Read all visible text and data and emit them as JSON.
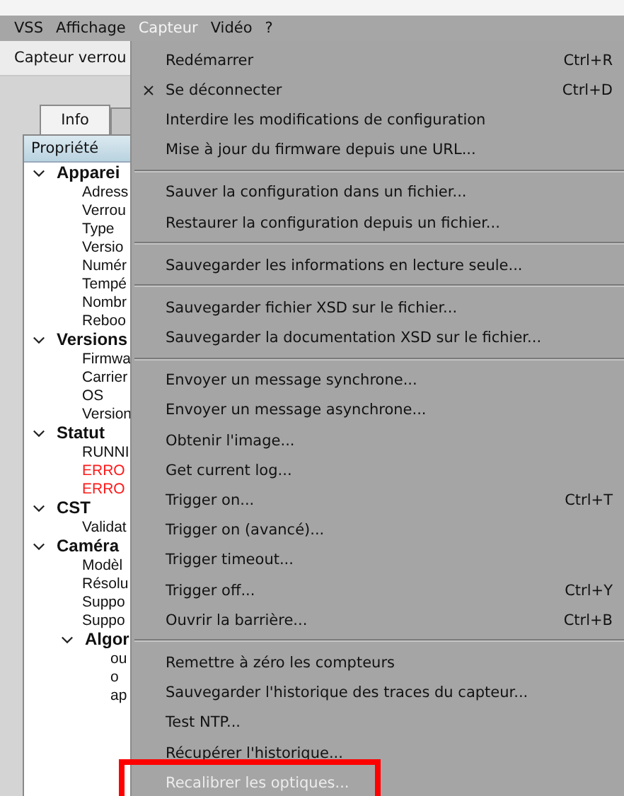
{
  "menubar": [
    {
      "label": "VSS",
      "selected": false
    },
    {
      "label": "Affichage",
      "selected": false
    },
    {
      "label": "Capteur",
      "selected": true
    },
    {
      "label": "Vidéo",
      "selected": false
    },
    {
      "label": "?",
      "selected": false
    }
  ],
  "window_label": "Capteur verrou",
  "tabs": [
    {
      "label": "Info",
      "selected": true
    },
    {
      "selected": false
    }
  ],
  "tree": {
    "header": "Propriété",
    "items": [
      {
        "label": "Apparei",
        "expanded": true,
        "children": [
          {
            "label": "Adress"
          },
          {
            "label": "Verrou"
          },
          {
            "label": "Type"
          },
          {
            "label": "Versio"
          },
          {
            "label": "Numér"
          },
          {
            "label": "Tempé"
          },
          {
            "label": "Nombr"
          },
          {
            "label": "Reboo"
          }
        ]
      },
      {
        "label": "Versions",
        "expanded": true,
        "children": [
          {
            "label": "Firmwa"
          },
          {
            "label": "Carrier"
          },
          {
            "label": "OS"
          },
          {
            "label": "Version"
          }
        ]
      },
      {
        "label": "Statut",
        "expanded": true,
        "children": [
          {
            "label": "RUNNI",
            "error": false
          },
          {
            "label": "ERRO",
            "error": true
          },
          {
            "label": "ERRO",
            "error": true
          }
        ]
      },
      {
        "label": "CST",
        "expanded": true,
        "children": [
          {
            "label": "Validat"
          }
        ]
      },
      {
        "label": "Caméra",
        "expanded": true,
        "children": [
          {
            "label": "Modèl"
          },
          {
            "label": "Résolu"
          },
          {
            "label": "Suppo"
          },
          {
            "label": "Suppo"
          },
          {
            "label": "Algor",
            "expanded": true,
            "children": [
              {
                "label": "ou"
              },
              {
                "label": "o"
              },
              {
                "label": "ap"
              }
            ]
          }
        ]
      }
    ]
  },
  "menu": {
    "sections": [
      [
        {
          "label": "Redémarrer",
          "shortcut": "Ctrl+R",
          "checked": false,
          "disabled": false,
          "highlighted": false
        },
        {
          "label": "Se déconnecter",
          "shortcut": "Ctrl+D",
          "checked": true,
          "disabled": false,
          "highlighted": false
        },
        {
          "label": "Interdire les modifications de configuration",
          "checked": false,
          "disabled": false,
          "highlighted": false
        },
        {
          "label": "Mise à jour du firmware depuis une URL...",
          "checked": false,
          "disabled": false,
          "highlighted": false
        }
      ],
      [
        {
          "label": "Sauver la configuration dans un fichier...",
          "checked": false,
          "disabled": false,
          "highlighted": false
        },
        {
          "label": "Restaurer la configuration depuis un fichier...",
          "checked": false,
          "disabled": false,
          "highlighted": false
        }
      ],
      [
        {
          "label": "Sauvegarder les informations en lecture seule...",
          "checked": false,
          "disabled": false,
          "highlighted": false
        }
      ],
      [
        {
          "label": "Sauvegarder fichier XSD sur le fichier...",
          "checked": false,
          "disabled": false,
          "highlighted": false
        },
        {
          "label": "Sauvegarder la documentation XSD sur le fichier...",
          "checked": false,
          "disabled": false,
          "highlighted": false
        }
      ],
      [
        {
          "label": "Envoyer un message synchrone...",
          "checked": false,
          "disabled": false,
          "highlighted": false
        },
        {
          "label": "Envoyer un message asynchrone...",
          "checked": false,
          "disabled": false,
          "highlighted": false
        },
        {
          "label": "Obtenir l'image...",
          "checked": false,
          "disabled": false,
          "highlighted": false
        },
        {
          "label": "Get current log...",
          "checked": false,
          "disabled": false,
          "highlighted": false
        },
        {
          "label": "Trigger on...",
          "shortcut": "Ctrl+T",
          "checked": false,
          "disabled": false,
          "highlighted": false
        },
        {
          "label": "Trigger on (avancé)...",
          "checked": false,
          "disabled": false,
          "highlighted": false
        },
        {
          "label": "Trigger timeout...",
          "checked": false,
          "disabled": false,
          "highlighted": false
        },
        {
          "label": "Trigger off...",
          "shortcut": "Ctrl+Y",
          "checked": false,
          "disabled": false,
          "highlighted": false
        },
        {
          "label": "Ouvrir la barrière...",
          "shortcut": "Ctrl+B",
          "checked": false,
          "disabled": false,
          "highlighted": false
        }
      ],
      [
        {
          "label": "Remettre à zéro les compteurs",
          "checked": false,
          "disabled": false,
          "highlighted": false
        },
        {
          "label": "Sauvegarder l'historique des traces du capteur...",
          "checked": false,
          "disabled": false,
          "highlighted": false
        },
        {
          "label": "Test NTP...",
          "checked": false,
          "disabled": false,
          "highlighted": false
        },
        {
          "label": "Récupérer l'historique...",
          "checked": false,
          "disabled": false,
          "highlighted": false
        },
        {
          "label": "Recalibrer les optiques...",
          "checked": false,
          "disabled": true,
          "highlighted": true
        }
      ]
    ]
  }
}
